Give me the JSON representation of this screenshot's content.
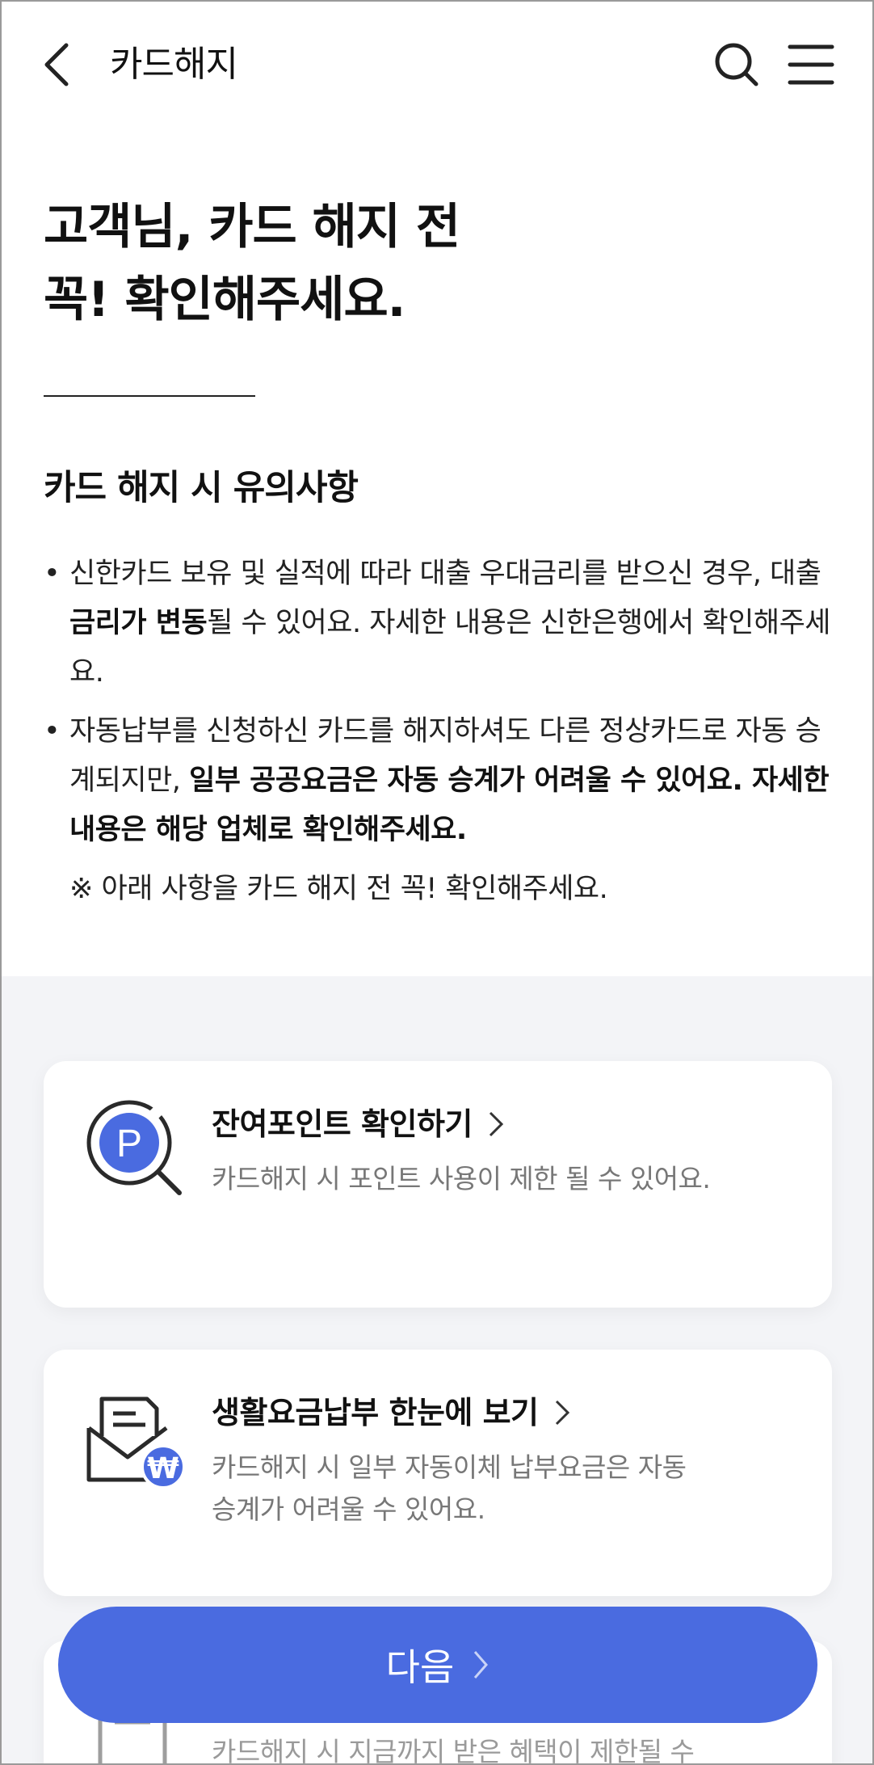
{
  "header": {
    "title": "카드해지"
  },
  "hero": {
    "line1": "고객님, 카드 해지 전",
    "line2": "꼭! 확인해주세요."
  },
  "notice": {
    "title": "카드 해지 시 유의사항",
    "item1": {
      "a": "신한카드 보유 및 실적에 따라 대출 우대금리를 받으신 경우, 대출 ",
      "bold": "금리가 변동",
      "b": "될 수 있어요. 자세한 내용은 신한은행에서 확인해주세요."
    },
    "item2": {
      "a": "자동납부를 신청하신 카드를 해지하셔도 다른 정상카드로 자동 승계되지만, ",
      "bold": "일부 공공요금은 자동 승계가 어려울 수 있어요. 자세한 내용은 해당 업체로 확인해주세요."
    },
    "star": "※  아래 사항을 카드 해지 전 꼭! 확인해주세요."
  },
  "cards": [
    {
      "title": "잔여포인트 확인하기",
      "desc": "카드해지 시 포인트 사용이 제한 될 수 있어요.",
      "icon": "point-search-icon"
    },
    {
      "title": "생활요금납부 한눈에 보기",
      "desc1": "카드해지 시 일부 자동이체 납부요금은 자동",
      "desc2": "승계가 어려울 수 있어요.",
      "icon": "mail-won-icon"
    },
    {
      "desc": "카드해지 시 지금까지 받은 혜택이 제한될 수",
      "icon": "document-icon"
    }
  ],
  "next_button": {
    "label": "다음"
  },
  "colors": {
    "accent": "#4a6be0",
    "background_gray": "#f3f4f7",
    "text": "#111111",
    "muted": "#777777"
  }
}
